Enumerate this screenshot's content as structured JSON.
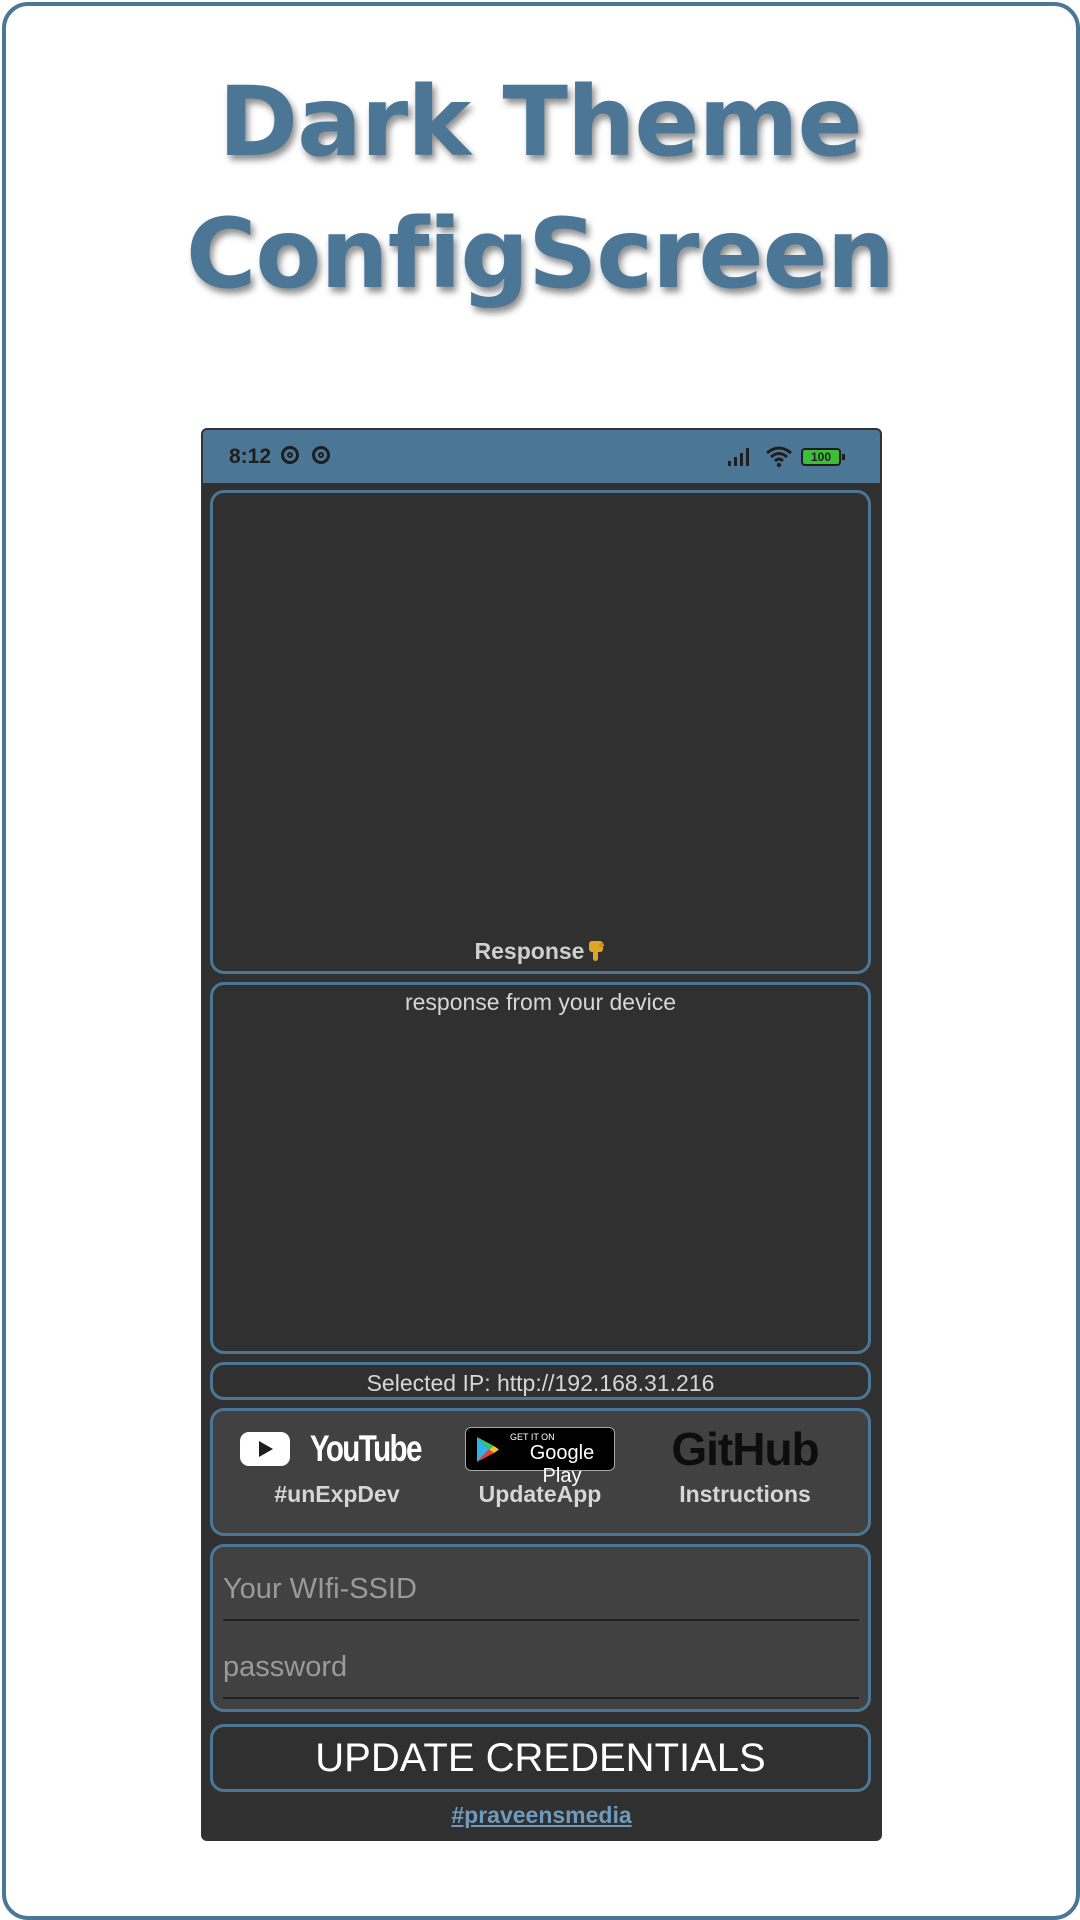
{
  "headline": {
    "line1": "Dark Theme",
    "line2": "ConfigScreen"
  },
  "status_bar": {
    "time": "8:12",
    "battery": "100",
    "icons": [
      "sync-icon",
      "sync-icon",
      "signal-icon",
      "wifi-icon",
      "battery-icon"
    ]
  },
  "response_panel": {
    "label": "Response",
    "icon": "pointing-down-hand-icon"
  },
  "device_panel": {
    "text": "response from your device"
  },
  "ip_panel": {
    "text": "Selected IP: http://192.168.31.216"
  },
  "links": [
    {
      "logo": "YouTube",
      "label": "#unExpDev"
    },
    {
      "logo_small": "GET IT ON",
      "logo": "Google Play",
      "label": "UpdateApp"
    },
    {
      "logo": "GitHub",
      "label": "Instructions"
    }
  ],
  "form": {
    "ssid_placeholder": "Your WIfi-SSID",
    "password_placeholder": "password"
  },
  "update_button": "UPDATE CREDENTIALS",
  "footer_link": "#praveensmedia",
  "colors": {
    "accent": "#4b7695",
    "background": "#303030",
    "panel": "#414141",
    "link": "#6e9bbd"
  }
}
